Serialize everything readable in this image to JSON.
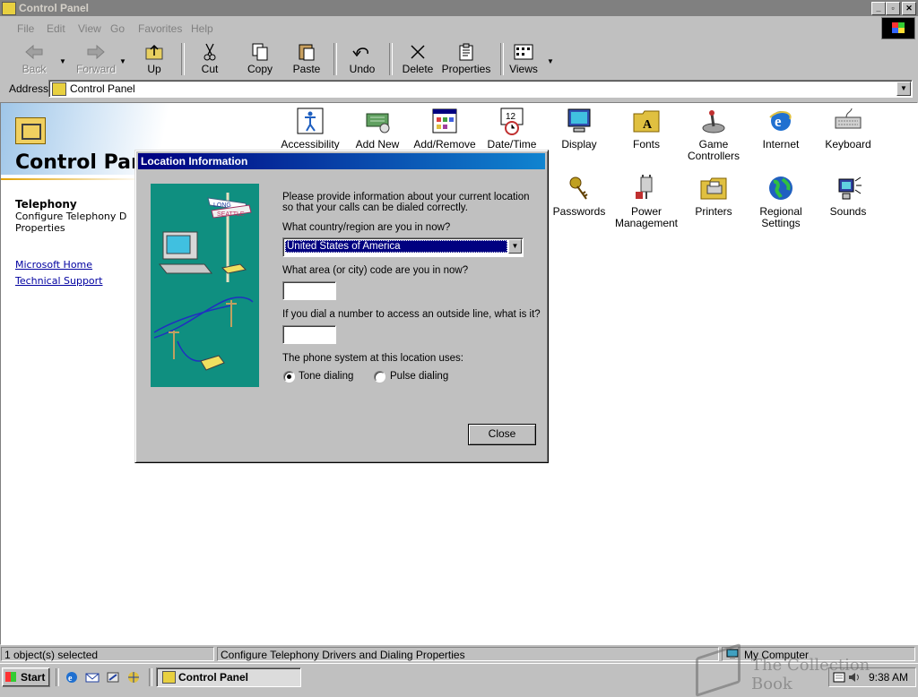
{
  "window": {
    "title": "Control Panel",
    "controls": {
      "minimize": "_",
      "maximize": "▫",
      "close": "✕"
    }
  },
  "menu": [
    {
      "label": "File"
    },
    {
      "label": "Edit"
    },
    {
      "label": "View"
    },
    {
      "label": "Go"
    },
    {
      "label": "Favorites"
    },
    {
      "label": "Help"
    }
  ],
  "toolbar": {
    "back": "Back",
    "forward": "Forward",
    "up": "Up",
    "cut": "Cut",
    "copy": "Copy",
    "paste": "Paste",
    "undo": "Undo",
    "delete": "Delete",
    "properties": "Properties",
    "views": "Views"
  },
  "address": {
    "label": "Address",
    "value": "Control Panel"
  },
  "sidebar": {
    "heading": "Control Panel",
    "selected_name": "Telephony",
    "selected_desc": "Configure Telephony D Properties",
    "links": [
      "Microsoft Home",
      "Technical Support"
    ]
  },
  "items": [
    {
      "label": "Accessibility",
      "icon": "accessibility-icon",
      "color": "#2060c0"
    },
    {
      "label": "Add New",
      "icon": "add-hardware-icon",
      "color": "#40a040"
    },
    {
      "label": "Add/Remove",
      "icon": "add-remove-programs-icon",
      "color": "#6080c0"
    },
    {
      "label": "Date/Time",
      "icon": "clock-calendar-icon",
      "color": "#c03030"
    },
    {
      "label": "Display",
      "icon": "monitor-icon",
      "color": "#3050b0"
    },
    {
      "label": "Fonts",
      "icon": "fonts-folder-icon",
      "color": "#e0c040"
    },
    {
      "label": "Game Controllers",
      "icon": "joystick-icon",
      "color": "#808080"
    },
    {
      "label": "Internet",
      "icon": "internet-explorer-icon",
      "color": "#2070d0"
    },
    {
      "label": "Keyboard",
      "icon": "keyboard-icon",
      "color": "#a0a0a0"
    },
    {
      "label": "Passwords",
      "icon": "keys-icon",
      "color": "#c0a020"
    },
    {
      "label": "Power Management",
      "icon": "power-plug-icon",
      "color": "#909090"
    },
    {
      "label": "Printers",
      "icon": "printer-folder-icon",
      "color": "#e0c040"
    },
    {
      "label": "Regional Settings",
      "icon": "globe-icon",
      "color": "#30a040"
    },
    {
      "label": "Sounds",
      "icon": "speaker-icon",
      "color": "#3040a0"
    }
  ],
  "dialog": {
    "title": "Location Information",
    "intro": "Please provide information about your current location so that your calls can be dialed correctly.",
    "country_label": "What country/region are you in now?",
    "country_value": "United States of America",
    "area_label": "What area (or city) code are you in now?",
    "area_value": "",
    "outside_label": "If you dial a number to access an outside line, what is it?",
    "outside_value": "",
    "phone_system_label": "The phone system at this location uses:",
    "tone": "Tone dialing",
    "pulse": "Pulse dialing",
    "selected_dialing": "tone",
    "close": "Close",
    "sign_long": "LONG",
    "sign_seattle": "SEATTLE"
  },
  "status": {
    "selection": "1 object(s) selected",
    "description": "Configure Telephony Drivers and Dialing Properties",
    "zone": "My Computer"
  },
  "taskbar": {
    "start": "Start",
    "task": "Control Panel",
    "clock": "9:38 AM"
  },
  "watermark": "The Collection Book"
}
